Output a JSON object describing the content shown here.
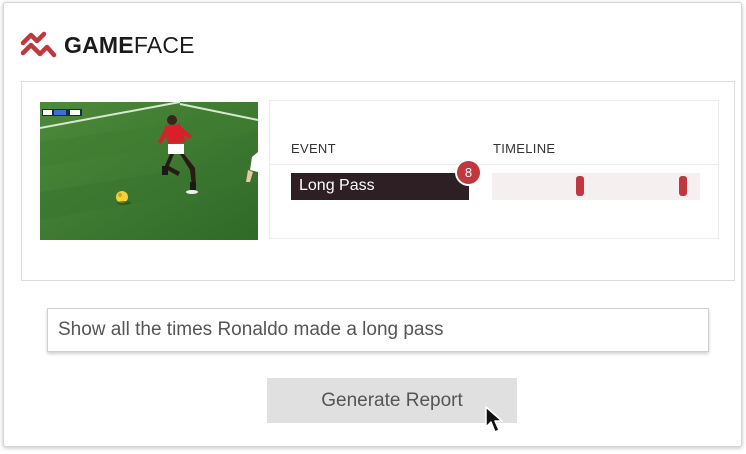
{
  "brand": {
    "name_bold": "GAME",
    "name_regular": "FACE",
    "logo_icon": "zigzag-arrows-icon",
    "logo_color": "#c0383d"
  },
  "video": {
    "thumbnail": "soccer-player-red-kit-dribbling-ball",
    "scoreboard": [
      "MNU",
      "LIV"
    ]
  },
  "events": {
    "col_event": "EVENT",
    "col_timeline": "TIMELINE",
    "rows": [
      {
        "label": "Long Pass",
        "count": "8",
        "timeline_markers": [
          0.42,
          0.92
        ]
      }
    ]
  },
  "query": {
    "value": "Show all the times Ronaldo made a long pass"
  },
  "actions": {
    "generate_label": "Generate Report"
  },
  "colors": {
    "accent": "#c0383d",
    "event_bg": "#2e1f24",
    "timeline_bg": "#f6efef",
    "button_bg": "#e0e0e0"
  }
}
